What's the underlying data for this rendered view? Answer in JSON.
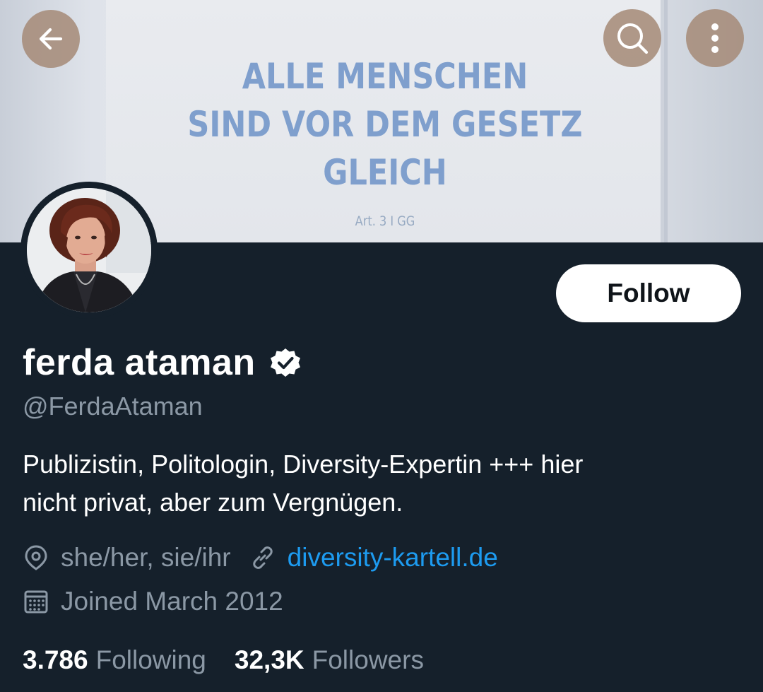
{
  "banner": {
    "lines": [
      "ALLE MENSCHEN",
      "SIND VOR DEM GESETZ",
      "GLEICH"
    ],
    "caption": "Art. 3 I GG"
  },
  "icons": {
    "back": "arrow-left-icon",
    "search": "search-icon",
    "more": "more-vertical-icon",
    "verified": "verified-badge-icon",
    "location": "location-pin-icon",
    "link": "link-icon",
    "calendar": "calendar-icon"
  },
  "profile": {
    "display_name": "ferda ataman",
    "handle": "@FerdaAtaman",
    "bio_lines": [
      "Publizistin, Politologin, Diversity-Expertin +++ hier",
      "nicht privat, aber zum Vergnügen."
    ],
    "location": "she/her, sie/ihr",
    "website": "diversity-kartell.de",
    "joined": "Joined March 2012"
  },
  "actions": {
    "follow_label": "Follow"
  },
  "stats": {
    "following_count": "3.786",
    "following_label": "Following",
    "followers_count": "32,3K",
    "followers_label": "Followers"
  },
  "colors": {
    "background": "#15202b",
    "primary_text": "#ffffff",
    "secondary_text": "#8b98a5",
    "link": "#1d9bf0",
    "banner_text": "#7f9fcd",
    "overlay_button": "#a68c7a"
  }
}
